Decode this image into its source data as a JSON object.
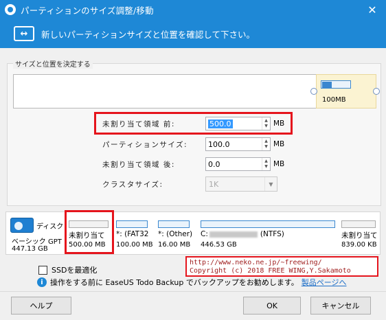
{
  "window": {
    "title": "パーティションのサイズ調整/移動",
    "close_icon": "close-icon"
  },
  "header": {
    "text": "新しいパーティションサイズと位置を確認して下さい。",
    "icon": "resize-arrows-icon"
  },
  "group": {
    "label": "サイズと位置を決定する"
  },
  "partition_bar": {
    "size_label": "100MB",
    "fill_fraction": 0.3
  },
  "fields": {
    "unalloc_before": {
      "label": "未割り当て領域 前:",
      "value": "500.0",
      "unit": "MB"
    },
    "partition_size": {
      "label": "パーティションサイズ:",
      "value": "100.0",
      "unit": "MB"
    },
    "unalloc_after": {
      "label": "未割り当て領域 後:",
      "value": "0.0",
      "unit": "MB"
    },
    "cluster_size": {
      "label": "クラスタサイズ:",
      "value": "1K"
    }
  },
  "disk": {
    "name": "ディスク",
    "type": "ベーシック GPT",
    "size": "447.13 GB",
    "partitions": [
      {
        "label": "未割り当て",
        "size": "500.00 MB"
      },
      {
        "label": "*: (FAT32",
        "size": "100.00 MB"
      },
      {
        "label": "*: (Other)",
        "size": "16.00 MB"
      },
      {
        "label_prefix": "C:",
        "label_suffix": "(NTFS)",
        "size": "446.53 GB"
      },
      {
        "label": "未割り当て",
        "size": "839.00 KB"
      }
    ]
  },
  "ssd_option": {
    "label": "SSDを最適化",
    "checked": false
  },
  "info": {
    "text": "操作をする前に EaseUS Todo Backup でバックアップをお勧めします。",
    "link": "製品ページへ"
  },
  "overlay": {
    "line1": "http://www.neko.ne.jp/~freewing/",
    "line2": "Copyright (c) 2018 FREE WING,Y.Sakamoto"
  },
  "buttons": {
    "help": "ヘルプ",
    "ok": "OK",
    "cancel": "キャンセル"
  },
  "colors": {
    "accent": "#1e88d6",
    "highlight": "#e5141c"
  }
}
